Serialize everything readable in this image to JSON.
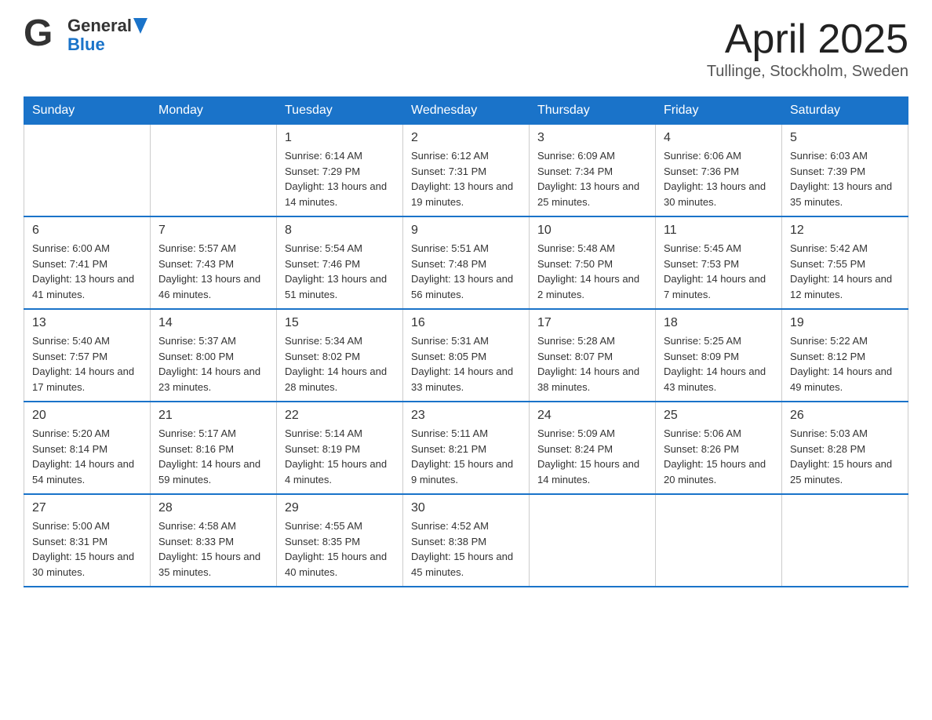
{
  "header": {
    "logo": {
      "general": "General",
      "blue": "Blue"
    },
    "title": "April 2025",
    "location": "Tullinge, Stockholm, Sweden"
  },
  "weekdays": [
    "Sunday",
    "Monday",
    "Tuesday",
    "Wednesday",
    "Thursday",
    "Friday",
    "Saturday"
  ],
  "weeks": [
    [
      {
        "day": "",
        "sunrise": "",
        "sunset": "",
        "daylight": ""
      },
      {
        "day": "",
        "sunrise": "",
        "sunset": "",
        "daylight": ""
      },
      {
        "day": "1",
        "sunrise": "Sunrise: 6:14 AM",
        "sunset": "Sunset: 7:29 PM",
        "daylight": "Daylight: 13 hours and 14 minutes."
      },
      {
        "day": "2",
        "sunrise": "Sunrise: 6:12 AM",
        "sunset": "Sunset: 7:31 PM",
        "daylight": "Daylight: 13 hours and 19 minutes."
      },
      {
        "day": "3",
        "sunrise": "Sunrise: 6:09 AM",
        "sunset": "Sunset: 7:34 PM",
        "daylight": "Daylight: 13 hours and 25 minutes."
      },
      {
        "day": "4",
        "sunrise": "Sunrise: 6:06 AM",
        "sunset": "Sunset: 7:36 PM",
        "daylight": "Daylight: 13 hours and 30 minutes."
      },
      {
        "day": "5",
        "sunrise": "Sunrise: 6:03 AM",
        "sunset": "Sunset: 7:39 PM",
        "daylight": "Daylight: 13 hours and 35 minutes."
      }
    ],
    [
      {
        "day": "6",
        "sunrise": "Sunrise: 6:00 AM",
        "sunset": "Sunset: 7:41 PM",
        "daylight": "Daylight: 13 hours and 41 minutes."
      },
      {
        "day": "7",
        "sunrise": "Sunrise: 5:57 AM",
        "sunset": "Sunset: 7:43 PM",
        "daylight": "Daylight: 13 hours and 46 minutes."
      },
      {
        "day": "8",
        "sunrise": "Sunrise: 5:54 AM",
        "sunset": "Sunset: 7:46 PM",
        "daylight": "Daylight: 13 hours and 51 minutes."
      },
      {
        "day": "9",
        "sunrise": "Sunrise: 5:51 AM",
        "sunset": "Sunset: 7:48 PM",
        "daylight": "Daylight: 13 hours and 56 minutes."
      },
      {
        "day": "10",
        "sunrise": "Sunrise: 5:48 AM",
        "sunset": "Sunset: 7:50 PM",
        "daylight": "Daylight: 14 hours and 2 minutes."
      },
      {
        "day": "11",
        "sunrise": "Sunrise: 5:45 AM",
        "sunset": "Sunset: 7:53 PM",
        "daylight": "Daylight: 14 hours and 7 minutes."
      },
      {
        "day": "12",
        "sunrise": "Sunrise: 5:42 AM",
        "sunset": "Sunset: 7:55 PM",
        "daylight": "Daylight: 14 hours and 12 minutes."
      }
    ],
    [
      {
        "day": "13",
        "sunrise": "Sunrise: 5:40 AM",
        "sunset": "Sunset: 7:57 PM",
        "daylight": "Daylight: 14 hours and 17 minutes."
      },
      {
        "day": "14",
        "sunrise": "Sunrise: 5:37 AM",
        "sunset": "Sunset: 8:00 PM",
        "daylight": "Daylight: 14 hours and 23 minutes."
      },
      {
        "day": "15",
        "sunrise": "Sunrise: 5:34 AM",
        "sunset": "Sunset: 8:02 PM",
        "daylight": "Daylight: 14 hours and 28 minutes."
      },
      {
        "day": "16",
        "sunrise": "Sunrise: 5:31 AM",
        "sunset": "Sunset: 8:05 PM",
        "daylight": "Daylight: 14 hours and 33 minutes."
      },
      {
        "day": "17",
        "sunrise": "Sunrise: 5:28 AM",
        "sunset": "Sunset: 8:07 PM",
        "daylight": "Daylight: 14 hours and 38 minutes."
      },
      {
        "day": "18",
        "sunrise": "Sunrise: 5:25 AM",
        "sunset": "Sunset: 8:09 PM",
        "daylight": "Daylight: 14 hours and 43 minutes."
      },
      {
        "day": "19",
        "sunrise": "Sunrise: 5:22 AM",
        "sunset": "Sunset: 8:12 PM",
        "daylight": "Daylight: 14 hours and 49 minutes."
      }
    ],
    [
      {
        "day": "20",
        "sunrise": "Sunrise: 5:20 AM",
        "sunset": "Sunset: 8:14 PM",
        "daylight": "Daylight: 14 hours and 54 minutes."
      },
      {
        "day": "21",
        "sunrise": "Sunrise: 5:17 AM",
        "sunset": "Sunset: 8:16 PM",
        "daylight": "Daylight: 14 hours and 59 minutes."
      },
      {
        "day": "22",
        "sunrise": "Sunrise: 5:14 AM",
        "sunset": "Sunset: 8:19 PM",
        "daylight": "Daylight: 15 hours and 4 minutes."
      },
      {
        "day": "23",
        "sunrise": "Sunrise: 5:11 AM",
        "sunset": "Sunset: 8:21 PM",
        "daylight": "Daylight: 15 hours and 9 minutes."
      },
      {
        "day": "24",
        "sunrise": "Sunrise: 5:09 AM",
        "sunset": "Sunset: 8:24 PM",
        "daylight": "Daylight: 15 hours and 14 minutes."
      },
      {
        "day": "25",
        "sunrise": "Sunrise: 5:06 AM",
        "sunset": "Sunset: 8:26 PM",
        "daylight": "Daylight: 15 hours and 20 minutes."
      },
      {
        "day": "26",
        "sunrise": "Sunrise: 5:03 AM",
        "sunset": "Sunset: 8:28 PM",
        "daylight": "Daylight: 15 hours and 25 minutes."
      }
    ],
    [
      {
        "day": "27",
        "sunrise": "Sunrise: 5:00 AM",
        "sunset": "Sunset: 8:31 PM",
        "daylight": "Daylight: 15 hours and 30 minutes."
      },
      {
        "day": "28",
        "sunrise": "Sunrise: 4:58 AM",
        "sunset": "Sunset: 8:33 PM",
        "daylight": "Daylight: 15 hours and 35 minutes."
      },
      {
        "day": "29",
        "sunrise": "Sunrise: 4:55 AM",
        "sunset": "Sunset: 8:35 PM",
        "daylight": "Daylight: 15 hours and 40 minutes."
      },
      {
        "day": "30",
        "sunrise": "Sunrise: 4:52 AM",
        "sunset": "Sunset: 8:38 PM",
        "daylight": "Daylight: 15 hours and 45 minutes."
      },
      {
        "day": "",
        "sunrise": "",
        "sunset": "",
        "daylight": ""
      },
      {
        "day": "",
        "sunrise": "",
        "sunset": "",
        "daylight": ""
      },
      {
        "day": "",
        "sunrise": "",
        "sunset": "",
        "daylight": ""
      }
    ]
  ]
}
